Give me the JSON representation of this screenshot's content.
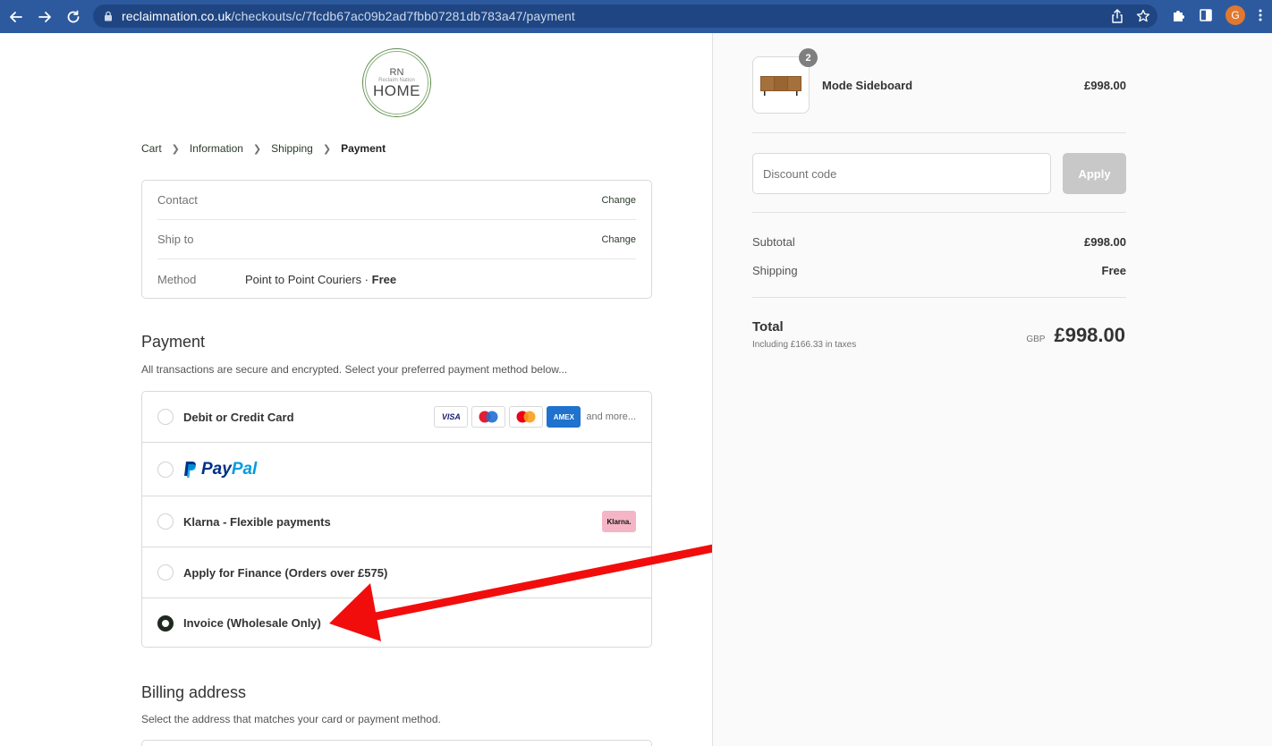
{
  "browser": {
    "url_host": "reclaimnation.co.uk",
    "url_path": "/checkouts/c/7fcdb67ac09b2ad7fbb07281db783a47/payment",
    "avatar_letter": "G"
  },
  "logo": {
    "line1": "RN",
    "line2": "Reclaim Nation",
    "line3": "HOME"
  },
  "breadcrumb": {
    "items": [
      "Cart",
      "Information",
      "Shipping",
      "Payment"
    ],
    "active": "Payment"
  },
  "review": {
    "contact_label": "Contact",
    "ship_to_label": "Ship to",
    "method_label": "Method",
    "method_value": "Point to Point Couriers · ",
    "method_price": "Free",
    "change_label": "Change"
  },
  "payment": {
    "title": "Payment",
    "subtitle": "All transactions are secure and encrypted. Select your preferred payment method below...",
    "options": [
      {
        "label": "Debit or Credit Card",
        "selected": false
      },
      {
        "label": "PayPal",
        "selected": false
      },
      {
        "label": "Klarna - Flexible payments",
        "selected": false
      },
      {
        "label": "Apply for Finance (Orders over £575)",
        "selected": false
      },
      {
        "label": "Invoice (Wholesale Only)",
        "selected": true
      }
    ],
    "card_brands": [
      "VISA",
      "Maestro",
      "Mastercard",
      "AMEX"
    ],
    "and_more": "and more...",
    "klarna_badge": "Klarna.",
    "paypal_pay": "Pay",
    "paypal_pal": "Pal"
  },
  "billing": {
    "title": "Billing address",
    "subtitle": "Select the address that matches your card or payment method."
  },
  "order": {
    "product_name": "Mode Sideboard",
    "product_price": "£998.00",
    "quantity": "2",
    "discount_placeholder": "Discount code",
    "apply_label": "Apply",
    "subtotal_label": "Subtotal",
    "subtotal_value": "£998.00",
    "shipping_label": "Shipping",
    "shipping_value": "Free",
    "total_label": "Total",
    "tax_note": "Including £166.33 in taxes",
    "currency": "GBP",
    "total_value": "£998.00"
  },
  "colors": {
    "chrome": "#2d5a9e",
    "annotation_arrow": "#f20d0d",
    "selected_radio": "#1d2a1d"
  }
}
